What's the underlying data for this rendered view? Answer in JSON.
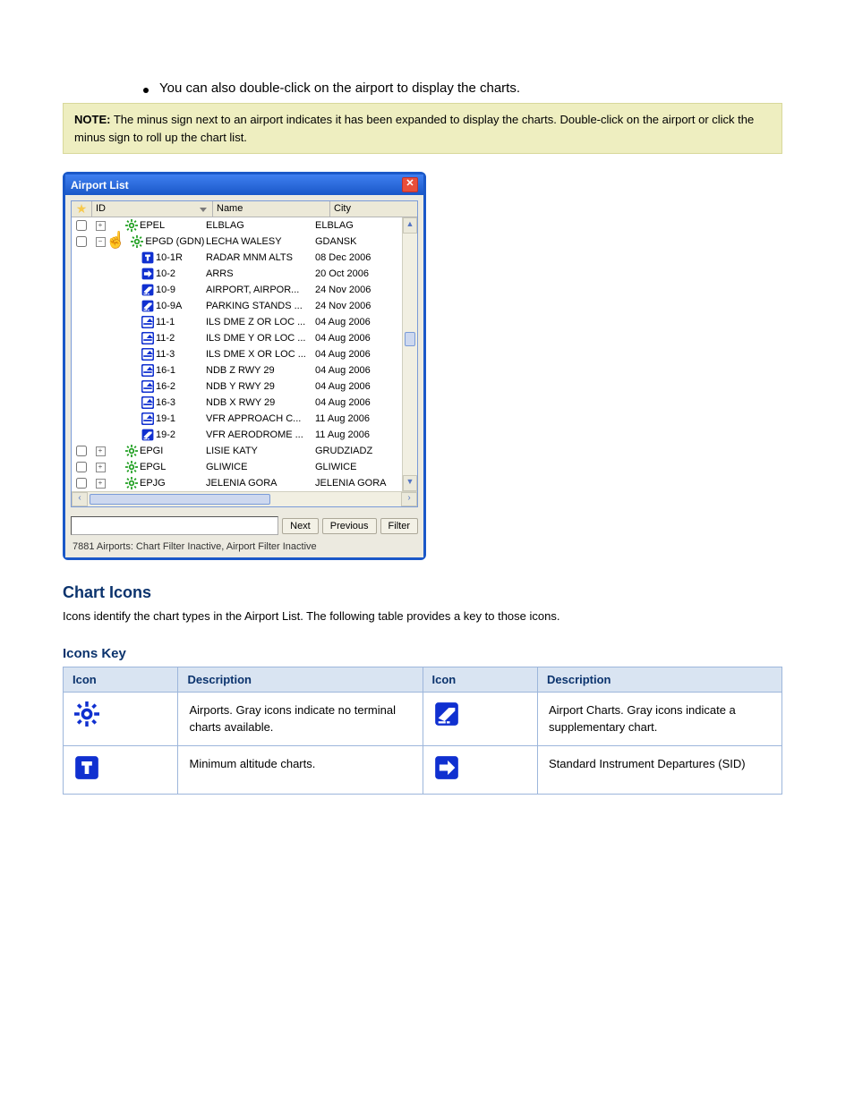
{
  "bullet_text": "You can also double-click on the airport to display the charts.",
  "note": {
    "label": "NOTE:",
    "text": "The minus sign next to an airport indicates it has been expanded to display the charts. Double-click on the airport or click the minus sign to roll up the chart list."
  },
  "window": {
    "title": "Airport List",
    "columns": {
      "star": "★",
      "id": "ID",
      "name": "Name",
      "city": "City"
    },
    "airports": [
      {
        "check": true,
        "exp": "+",
        "id": "EPEL",
        "name": "ELBLAG",
        "city": "ELBLAG"
      },
      {
        "check": true,
        "exp": "-",
        "id": "EPGD (GDN)",
        "name": "LECHA WALESY",
        "city": "GDANSK",
        "cursor": true
      }
    ],
    "charts": [
      {
        "icon": "mea",
        "id": "10-1R",
        "name": "RADAR MNM ALTS",
        "city": "08 Dec 2006"
      },
      {
        "icon": "arr",
        "id": "10-2",
        "name": "ARRS",
        "city": "20 Oct 2006"
      },
      {
        "icon": "apt",
        "id": "10-9",
        "name": "AIRPORT, AIRPOR...",
        "city": "24 Nov 2006"
      },
      {
        "icon": "apt",
        "id": "10-9A",
        "name": "PARKING STANDS ...",
        "city": "24 Nov 2006"
      },
      {
        "icon": "apr",
        "id": "11-1",
        "name": "ILS DME Z OR LOC ...",
        "city": "04 Aug 2006"
      },
      {
        "icon": "apr",
        "id": "11-2",
        "name": "ILS DME Y OR LOC ...",
        "city": "04 Aug 2006"
      },
      {
        "icon": "apr",
        "id": "11-3",
        "name": "ILS DME X OR LOC ...",
        "city": "04 Aug 2006"
      },
      {
        "icon": "apr",
        "id": "16-1",
        "name": "NDB Z RWY 29",
        "city": "04 Aug 2006"
      },
      {
        "icon": "apr",
        "id": "16-2",
        "name": "NDB Y RWY 29",
        "city": "04 Aug 2006"
      },
      {
        "icon": "apr",
        "id": "16-3",
        "name": "NDB X RWY 29",
        "city": "04 Aug 2006"
      },
      {
        "icon": "apr",
        "id": "19-1",
        "name": "VFR APPROACH C...",
        "city": "11 Aug 2006"
      },
      {
        "icon": "apt",
        "id": "19-2",
        "name": "VFR AERODROME ...",
        "city": "11 Aug 2006"
      }
    ],
    "airports_after": [
      {
        "check": true,
        "exp": "+",
        "id": "EPGI",
        "name": "LISIE KATY",
        "city": "GRUDZIADZ"
      },
      {
        "check": true,
        "exp": "+",
        "id": "EPGL",
        "name": "GLIWICE",
        "city": "GLIWICE"
      },
      {
        "check": true,
        "exp": "+",
        "id": "EPJG",
        "name": "JELENIA GORA",
        "city": "JELENIA GORA"
      }
    ],
    "buttons": {
      "next": "Next",
      "previous": "Previous",
      "filter": "Filter"
    },
    "status": "7881 Airports: Chart Filter Inactive, Airport Filter Inactive"
  },
  "icons_section": {
    "heading": "Chart Icons",
    "text": "Icons identify the chart types in the Airport List. The following table provides a key to those icons.",
    "subhead": "Icons Key",
    "headers": {
      "c1": "Icon",
      "c2": "Description",
      "c3": "Icon",
      "c4": "Description"
    },
    "rows": [
      {
        "l_desc": "Airports. Gray icons indicate no terminal charts available.",
        "r_desc": "Airport Charts. Gray icons indicate a supplementary chart."
      },
      {
        "l_desc": "Minimum altitude charts.",
        "r_desc": "Standard Instrument Departures (SID)"
      }
    ]
  }
}
